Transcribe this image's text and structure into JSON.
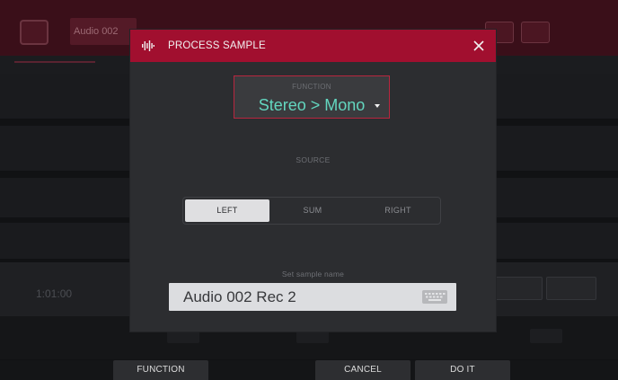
{
  "background": {
    "header_title": "Audio 002",
    "counter": "1:01:00"
  },
  "modal": {
    "title": "PROCESS SAMPLE",
    "icon": "waveform-icon",
    "close_icon": "close-icon",
    "function_label": "FUNCTION",
    "function_value": "Stereo > Mono",
    "source_label": "SOURCE",
    "source_options": [
      "LEFT",
      "SUM",
      "RIGHT"
    ],
    "source_selected": "LEFT",
    "name_label": "Set sample name",
    "name_value": "Audio 002 Rec 2",
    "keyboard_icon": "keyboard-icon"
  },
  "bottom_bar": {
    "function": "FUNCTION",
    "cancel": "CANCEL",
    "do_it": "DO IT"
  },
  "colors": {
    "accent_red": "#a10f2f",
    "value_teal": "#63d6bf",
    "modal_bg": "#2c2d30"
  }
}
